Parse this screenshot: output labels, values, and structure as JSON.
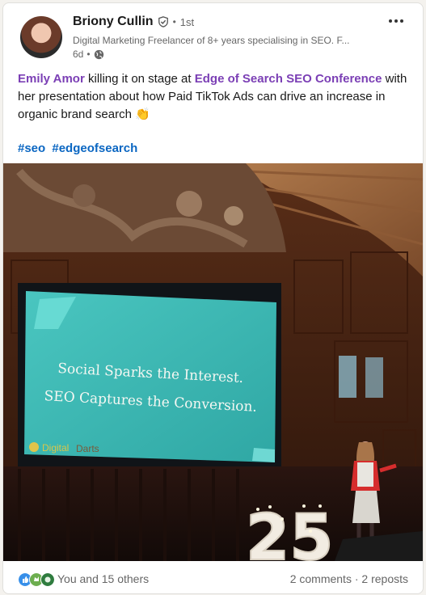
{
  "post": {
    "author_name": "Briony Cullin",
    "degree": "1st",
    "dot": "•",
    "headline": "Digital Marketing Freelancer of 8+ years specialising in SEO. F...",
    "age": "6d",
    "text_mention_1": "Emily Amor",
    "text_part_1": " killing it on stage at ",
    "text_mention_2": "Edge of Search SEO Conference",
    "text_part_2": " with her presentation about how Paid TikTok Ads can drive an increase in organic brand search ",
    "emoji": "👏",
    "hashtags": [
      "#seo",
      "#edgeofsearch"
    ]
  },
  "slide": {
    "line1": "Social Sparks the Interest.",
    "line2": "SEO Captures the Conversion.",
    "logo_word1": "Digital",
    "logo_word2": "Darts"
  },
  "stage_number": "25",
  "social": {
    "reactions_text": "You and 15 others",
    "comments": "2 comments",
    "separator": " · ",
    "reposts": "2 reposts"
  },
  "icons": {
    "verified": "shield-check-icon",
    "globe": "globe-icon",
    "more": "more-horizontal-icon",
    "reactions": [
      "like-icon",
      "celebrate-icon",
      "support-icon"
    ]
  },
  "colors": {
    "mention": "#7b3fb5",
    "hashtag": "#0a66c2",
    "secondary_text": "#666666",
    "slide": "#3fb8b2"
  }
}
